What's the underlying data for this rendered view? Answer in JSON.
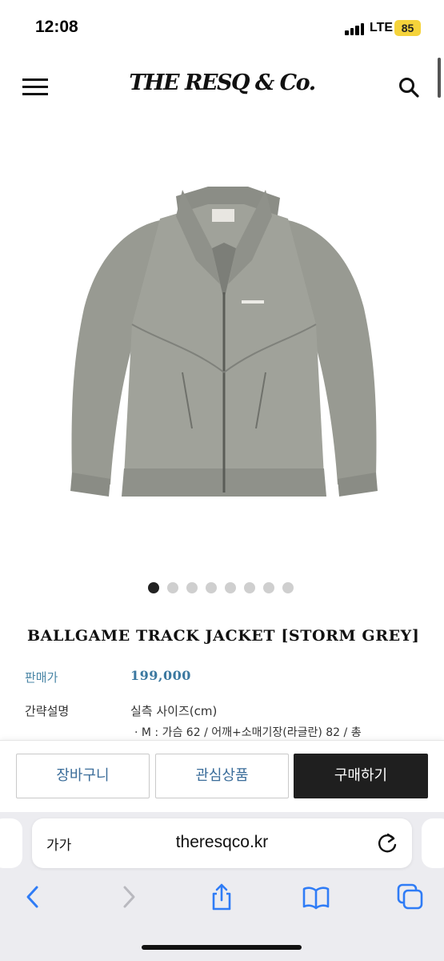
{
  "status_bar": {
    "time": "12:08",
    "network": "LTE",
    "battery": "85"
  },
  "header": {
    "logo": "THE RESQ & Co.",
    "menu_icon": "hamburger-menu-icon",
    "search_icon": "search-icon"
  },
  "product": {
    "image_icon": "grey-track-jacket-image",
    "carousel": {
      "count": 8,
      "active_index": 0
    },
    "title": "BALLGAME TRACK JACKET [STORM GREY]",
    "price_label": "판매가",
    "price": "199,000",
    "description_label": "간략설명",
    "description_heading": "실측 사이즈(cm)",
    "description_line": "· M : 가슴 62 / 어깨+소매기장(라글란) 82 / 총"
  },
  "actions": {
    "cart": "장바구니",
    "wishlist": "관심상품",
    "buy": "구매하기"
  },
  "browser": {
    "text_size": "가가",
    "url": "theresqco.kr",
    "reload_icon": "reload-icon",
    "nav_icons": [
      "back-icon",
      "forward-icon",
      "share-icon",
      "bookmarks-icon",
      "tabs-icon"
    ]
  },
  "colors": {
    "accent_blue": "#3b78a0",
    "buy_button": "#1f1f1f",
    "battery": "#f5d33b"
  }
}
